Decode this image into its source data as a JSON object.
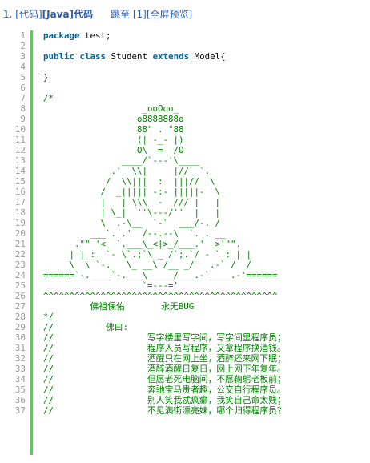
{
  "header": {
    "index": "1.",
    "title_part1": "[代码]",
    "title_part2": "[Java]",
    "title_part3": "代码",
    "jump_label": "跳至",
    "jump_index": "[1]",
    "fullscreen_label": "[全屏预览]"
  },
  "colors": {
    "link": "#2a5caa",
    "keyword": "#006699",
    "comment": "#008200",
    "bar": "#6ac36a",
    "line_number": "#9a9a9a"
  },
  "lines": [
    {
      "n": "1",
      "type": "code",
      "parts": [
        {
          "t": "package",
          "kw": true
        },
        {
          "t": " test;"
        }
      ]
    },
    {
      "n": "2",
      "type": "blank",
      "text": ""
    },
    {
      "n": "3",
      "type": "code",
      "parts": [
        {
          "t": "public",
          "kw": true
        },
        {
          "t": " "
        },
        {
          "t": "class",
          "kw": true
        },
        {
          "t": " Student "
        },
        {
          "t": "extends",
          "kw": true
        },
        {
          "t": " Model{"
        }
      ]
    },
    {
      "n": "4",
      "type": "blank",
      "text": ""
    },
    {
      "n": "5",
      "type": "code",
      "parts": [
        {
          "t": "}"
        }
      ]
    },
    {
      "n": "6",
      "type": "blank",
      "text": ""
    },
    {
      "n": "7",
      "type": "comment",
      "text": "/*"
    },
    {
      "n": "8",
      "type": "comment",
      "text": "                   _ooOoo_"
    },
    {
      "n": "9",
      "type": "comment",
      "text": "                  o8888888o"
    },
    {
      "n": "10",
      "type": "comment",
      "text": "                  88\" . \"88"
    },
    {
      "n": "11",
      "type": "comment",
      "text": "                  (| -_- |)"
    },
    {
      "n": "12",
      "type": "comment",
      "text": "                  O\\  =  /O"
    },
    {
      "n": "13",
      "type": "comment",
      "text": "               ____/`---'\\____"
    },
    {
      "n": "14",
      "type": "comment",
      "text": "             .'  \\\\|     |//  `."
    },
    {
      "n": "15",
      "type": "comment",
      "text": "            /  \\\\|||  :  |||//  \\"
    },
    {
      "n": "16",
      "type": "comment",
      "text": "           /  _||||| -:- |||||-  \\"
    },
    {
      "n": "17",
      "type": "comment",
      "text": "           |   | \\\\\\  -  /// |   |"
    },
    {
      "n": "18",
      "type": "comment",
      "text": "           | \\_|  ''\\---/''  |   |"
    },
    {
      "n": "19",
      "type": "comment",
      "text": "           \\  .-\\__  `-`  ___/-. /"
    },
    {
      "n": "20",
      "type": "comment",
      "text": "         ___`. .'  /--.--\\  `. . __"
    },
    {
      "n": "21",
      "type": "comment",
      "text": "      .\"\" '<  `.___\\_<|>_/___.'  >'\"\"."
    },
    {
      "n": "22",
      "type": "comment",
      "text": "     | | :  `- \\`.;`\\ _ /`;.`/ - ` : | |"
    },
    {
      "n": "23",
      "type": "comment",
      "text": "     \\  \\ `-.   \\_ __\\ /__ _/   .-` /  /"
    },
    {
      "n": "24",
      "type": "comment",
      "text": "======`-.____`-.___\\_____/___.-`____.-'======"
    },
    {
      "n": "25",
      "type": "comment",
      "text": "                   `=---='"
    },
    {
      "n": "26",
      "type": "comment",
      "text": "^^^^^^^^^^^^^^^^^^^^^^^^^^^^^^^^^^^^^^^^^^^^^"
    },
    {
      "n": "27",
      "type": "comment",
      "text": "         佛祖保佑       永无BUG"
    },
    {
      "n": "28",
      "type": "comment",
      "text": "*/"
    },
    {
      "n": "29",
      "type": "comment",
      "text": "//          佛曰:"
    },
    {
      "n": "30",
      "type": "comment",
      "text": "//                  写字楼里写字间，写字间里程序员；"
    },
    {
      "n": "31",
      "type": "comment",
      "text": "//                  程序人员写程序，又拿程序换酒钱。"
    },
    {
      "n": "32",
      "type": "comment",
      "text": "//                  酒醒只在网上坐，酒醉还来网下眠；"
    },
    {
      "n": "33",
      "type": "comment",
      "text": "//                  酒醉酒醒日复日，网上网下年复年。"
    },
    {
      "n": "34",
      "type": "comment",
      "text": "//                  但愿老死电脑间，不愿鞠躬老板前；"
    },
    {
      "n": "35",
      "type": "comment",
      "text": "//                  奔驰宝马贵者趣，公交自行程序员。"
    },
    {
      "n": "36",
      "type": "comment",
      "text": "//                  别人笑我忒疯癫，我笑自己命太贱；"
    },
    {
      "n": "37",
      "type": "comment",
      "text": "//                  不见满街漂亮妹，哪个归得程序员？"
    }
  ]
}
